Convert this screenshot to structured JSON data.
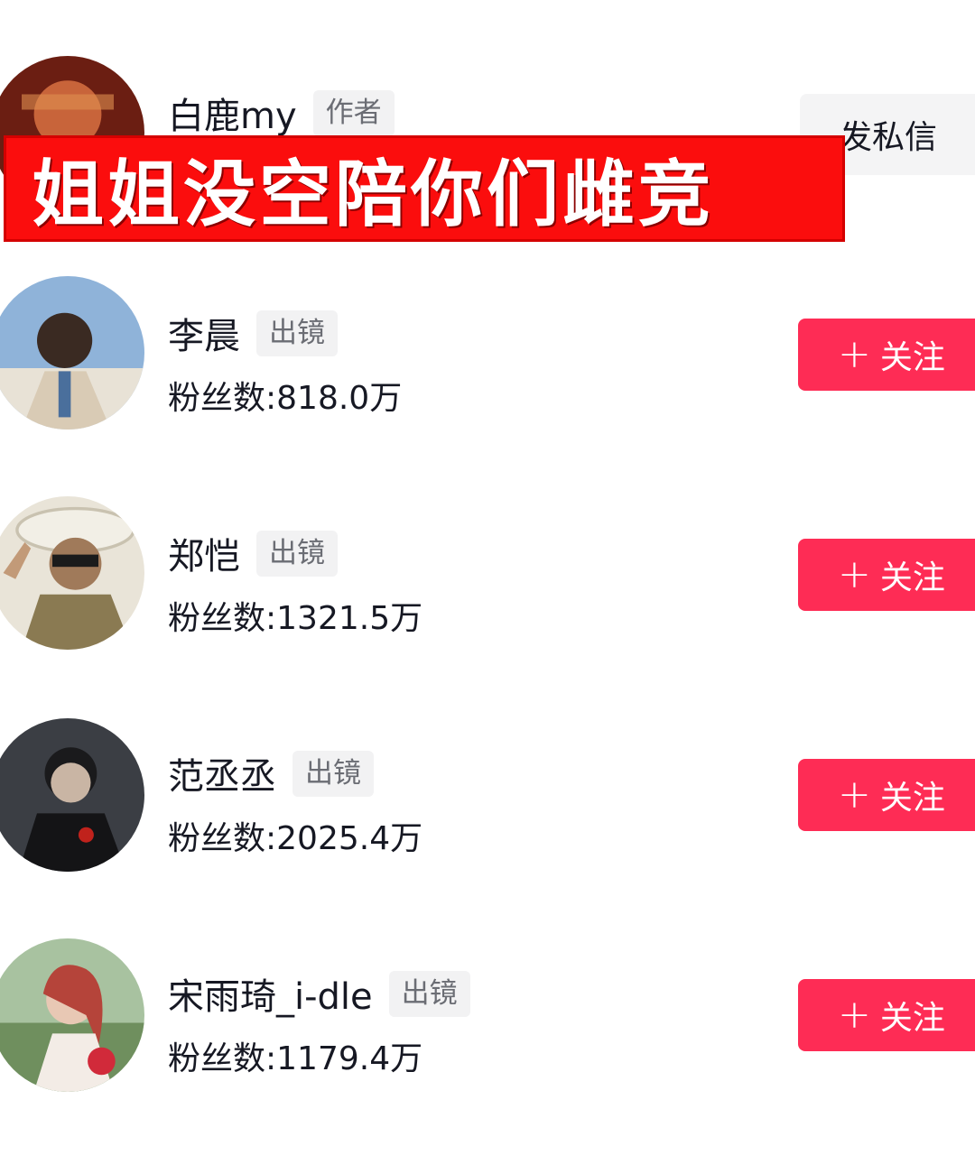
{
  "colors": {
    "accent": "#fe2c55",
    "banner": "#fb0d0d",
    "tag_bg": "#f2f2f3"
  },
  "banner": {
    "text": "姐姐没空陪你们雌竞"
  },
  "author": {
    "name": "白鹿my",
    "tag": "作者",
    "message_label": "发私信",
    "avatar_icon": "avatar-photo"
  },
  "users": [
    {
      "name": "李晨",
      "tag": "出镜",
      "fans": "粉丝数:818.0万",
      "follow_plus": "+",
      "follow_label": "关注",
      "avatar_icon": "avatar-photo"
    },
    {
      "name": "郑恺",
      "tag": "出镜",
      "fans": "粉丝数:1321.5万",
      "follow_plus": "+",
      "follow_label": "关注",
      "avatar_icon": "avatar-photo"
    },
    {
      "name": "范丞丞",
      "tag": "出镜",
      "fans": "粉丝数:2025.4万",
      "follow_plus": "+",
      "follow_label": "关注",
      "avatar_icon": "avatar-photo"
    },
    {
      "name": "宋雨琦_i-dle",
      "tag": "出镜",
      "fans": "粉丝数:1179.4万",
      "follow_plus": "+",
      "follow_label": "关注",
      "avatar_icon": "avatar-photo"
    }
  ]
}
